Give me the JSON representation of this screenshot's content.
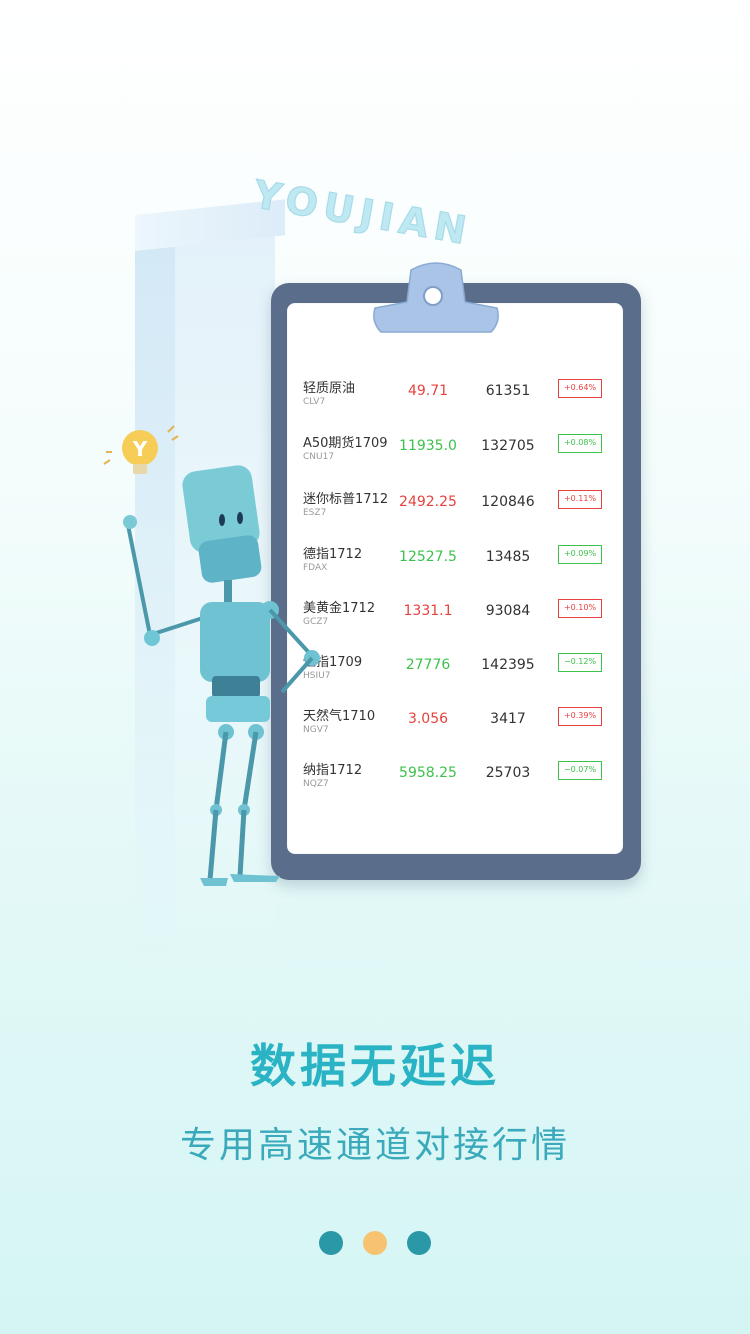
{
  "brand": {
    "text": "YOUJIAN"
  },
  "quotes": [
    {
      "name": "轻质原油",
      "code": "CLV7",
      "price": "49.71",
      "volume": "61351",
      "change": "+0.64%",
      "trend": "up"
    },
    {
      "name": "A50期货1709",
      "code": "CNU17",
      "price": "11935.0",
      "volume": "132705",
      "change": "+0.08%",
      "trend": "down"
    },
    {
      "name": "迷你标普1712",
      "code": "ESZ7",
      "price": "2492.25",
      "volume": "120846",
      "change": "+0.11%",
      "trend": "up"
    },
    {
      "name": "德指1712",
      "code": "FDAX",
      "price": "12527.5",
      "volume": "13485",
      "change": "+0.09%",
      "trend": "down"
    },
    {
      "name": "美黄金1712",
      "code": "GCZ7",
      "price": "1331.1",
      "volume": "93084",
      "change": "+0.10%",
      "trend": "up"
    },
    {
      "name": "恒指1709",
      "code": "HSIU7",
      "price": "27776",
      "volume": "142395",
      "change": "−0.12%",
      "trend": "down"
    },
    {
      "name": "天然气1710",
      "code": "NGV7",
      "price": "3.056",
      "volume": "3417",
      "change": "+0.39%",
      "trend": "up"
    },
    {
      "name": "纳指1712",
      "code": "NQZ7",
      "price": "5958.25",
      "volume": "25703",
      "change": "−0.07%",
      "trend": "down"
    }
  ],
  "headline": "数据无延迟",
  "subline": "专用高速通道对接行情",
  "pager": {
    "total": 3,
    "active_index": 1
  },
  "colors": {
    "up": "#e8413e",
    "down": "#3cc14b",
    "accent": "#2ab3c4",
    "dot": "#2a98a7",
    "dot_active": "#f7c370",
    "clipboard": "#5a6e8c"
  }
}
